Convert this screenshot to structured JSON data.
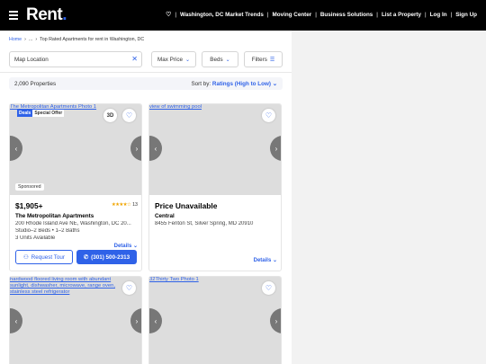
{
  "header": {
    "logo_text": "Rent",
    "logo_dot": ".",
    "nav": [
      "Washington, DC Market Trends",
      "Moving Center",
      "Business Solutions",
      "List a Property",
      "Log In",
      "Sign Up"
    ]
  },
  "breadcrumb": {
    "home": "Home",
    "ellipsis": "...",
    "current": "Top Rated Apartments for rent in Washington, DC"
  },
  "filters": {
    "search_value": "Map Location",
    "max_price": "Max Price",
    "beds": "Beds",
    "filters": "Filters"
  },
  "results": {
    "count": "2,090 Properties",
    "sort_label": "Sort by:",
    "sort_value": "Ratings (High to Low)"
  },
  "listings": [
    {
      "image_alt": "The Metropolitan Apartments Photo 1",
      "deal_tag": "Deals",
      "deal_text": "Special Offer",
      "tour_3d": "3D",
      "sponsored": "Sponsored",
      "price": "$1,905+",
      "rating_stars": "★★★★☆",
      "rating_count": "13",
      "name": "The Metropolitan Apartments",
      "address": "200 Rhode Island Ave NE, Washington, DC 20...",
      "beds_baths": "Studio–2 Beds • 1–2 Baths",
      "units": "3 Units Available",
      "details": "Details",
      "request_tour": "Request Tour",
      "phone": "(301) 500-2313"
    },
    {
      "image_alt": "view of swimming pool",
      "price": "Price Unavailable",
      "name": "Central",
      "address": "8455 Fenton St, Silver Spring, MD 20910",
      "details": "Details"
    },
    {
      "image_alt": "hardwood floored living room with abundant sunlight, dishwasher, microwave, range oven, stainless steel refrigerator"
    },
    {
      "image_alt": "32Thirty Two Photo 1"
    }
  ]
}
